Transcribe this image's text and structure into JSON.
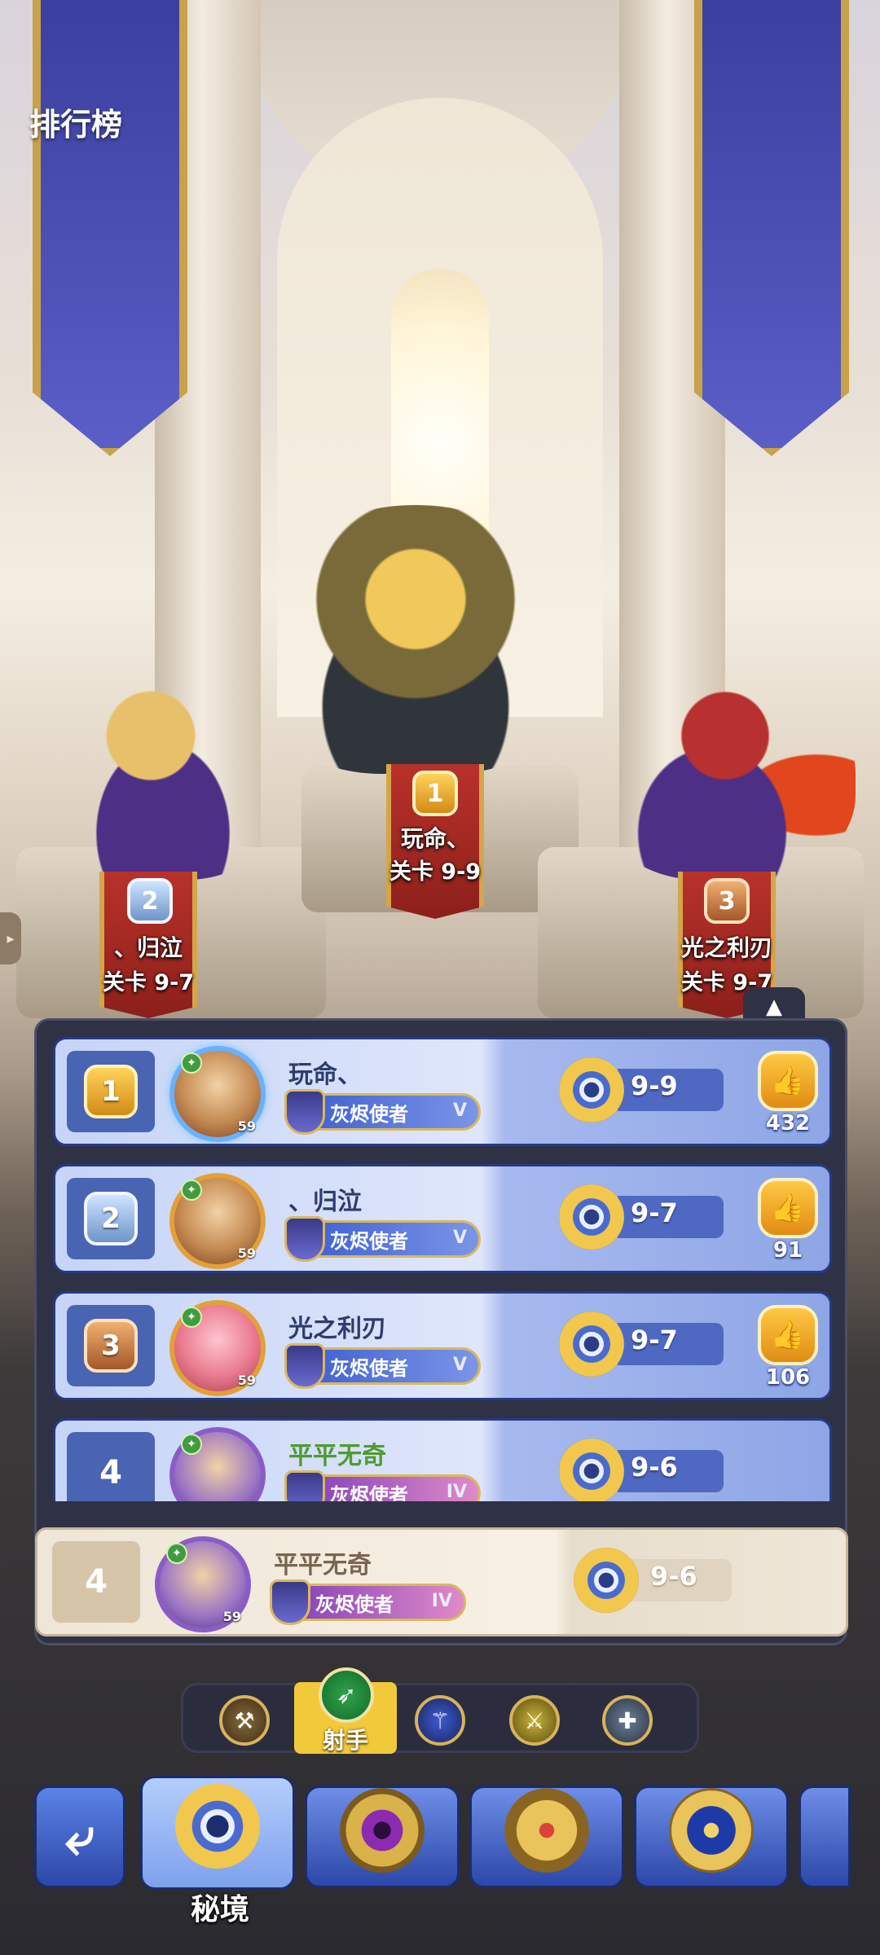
{
  "page": {
    "title": "排行榜"
  },
  "podium": [
    {
      "place": "1",
      "name": "玩命、",
      "stage": "关卡 9-9"
    },
    {
      "place": "2",
      "name": "、归泣",
      "stage": "关卡 9-7"
    },
    {
      "place": "3",
      "name": "光之利刃",
      "stage": "关卡 9-7"
    }
  ],
  "rows": [
    {
      "rank": "1",
      "name": "玩命、",
      "level": "59",
      "class_name": "灰烬使者",
      "class_tier": "V",
      "stage": "9-9",
      "likes": "432"
    },
    {
      "rank": "2",
      "name": "、归泣",
      "level": "59",
      "class_name": "灰烬使者",
      "class_tier": "V",
      "stage": "9-7",
      "likes": "91"
    },
    {
      "rank": "3",
      "name": "光之利刃",
      "level": "59",
      "class_name": "灰烬使者",
      "class_tier": "V",
      "stage": "9-7",
      "likes": "106"
    },
    {
      "rank": "4",
      "name": "平平无奇",
      "level": "59",
      "class_name": "灰烬使者",
      "class_tier": "IV",
      "stage": "9-6",
      "likes": ""
    }
  ],
  "my_row": {
    "rank": "4",
    "name": "平平无奇",
    "level": "59",
    "class_name": "灰烬使者",
    "class_tier": "IV",
    "stage": "9-6"
  },
  "filters": {
    "items": [
      {
        "icon": "axe-warrior-icon"
      },
      {
        "icon": "bow-archer-icon",
        "label": "射手",
        "selected": true
      },
      {
        "icon": "staff-mage-icon"
      },
      {
        "icon": "dagger-assassin-icon"
      },
      {
        "icon": "cross-priest-icon"
      }
    ]
  },
  "bottom_nav": {
    "back_icon": "back-arrow-icon",
    "modes": [
      {
        "icon": "secret-realm-icon",
        "label": "秘境",
        "selected": true
      },
      {
        "icon": "purple-eye-icon",
        "label": ""
      },
      {
        "icon": "crown-icon",
        "label": ""
      },
      {
        "icon": "compass-star-icon",
        "label": ""
      }
    ]
  },
  "colors": {
    "gold": "#f2c93a",
    "row_blue": "#263a86",
    "my_row_bg": "#efe6d7"
  }
}
